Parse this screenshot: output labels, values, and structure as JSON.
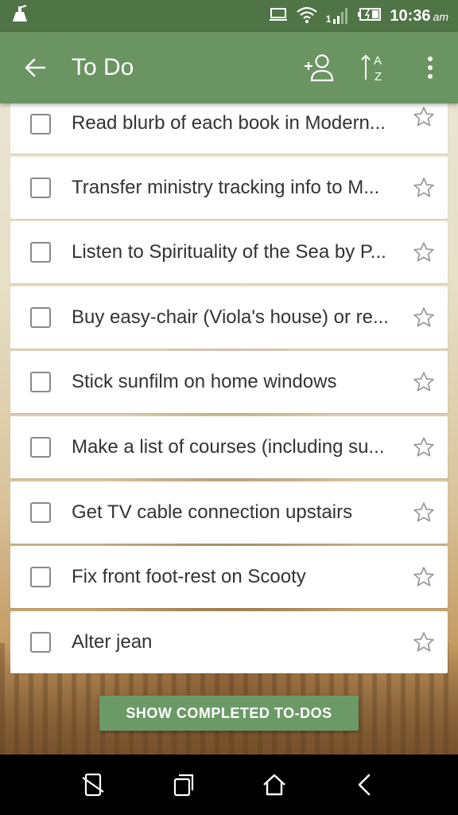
{
  "status_bar": {
    "time": "10:36",
    "ampm": "am",
    "signal_label": "1",
    "icons": [
      "cleaner-icon",
      "monitor-icon",
      "wifi-icon",
      "signal-icon",
      "battery-icon"
    ]
  },
  "app_bar": {
    "title": "To Do",
    "icons": [
      "back-arrow-icon",
      "add-person-icon",
      "sort-az-icon",
      "more-vert-icon"
    ]
  },
  "tasks": [
    {
      "text": "Read blurb of each book in Modern...",
      "checked": false,
      "starred": false
    },
    {
      "text": "Transfer ministry tracking info to M...",
      "checked": false,
      "starred": false
    },
    {
      "text": "Listen to Spirituality of the Sea by P...",
      "checked": false,
      "starred": false
    },
    {
      "text": "Buy easy-chair (Viola's house) or re...",
      "checked": false,
      "starred": false
    },
    {
      "text": "Stick sunfilm on home windows",
      "checked": false,
      "starred": false
    },
    {
      "text": "Make a list of courses (including su...",
      "checked": false,
      "starred": false
    },
    {
      "text": "Get TV cable connection upstairs",
      "checked": false,
      "starred": false
    },
    {
      "text": "Fix front foot-rest on Scooty",
      "checked": false,
      "starred": false
    },
    {
      "text": "Alter jean",
      "checked": false,
      "starred": false
    }
  ],
  "show_completed_label": "SHOW COMPLETED TO-DOS",
  "nav_bar": {
    "icons": [
      "recent-apps-crossed-icon",
      "overview-icon",
      "home-icon",
      "back-icon"
    ]
  },
  "colors": {
    "status_bar": "#4f7546",
    "app_bar": "#6a9462",
    "button": "#6c9a66"
  }
}
